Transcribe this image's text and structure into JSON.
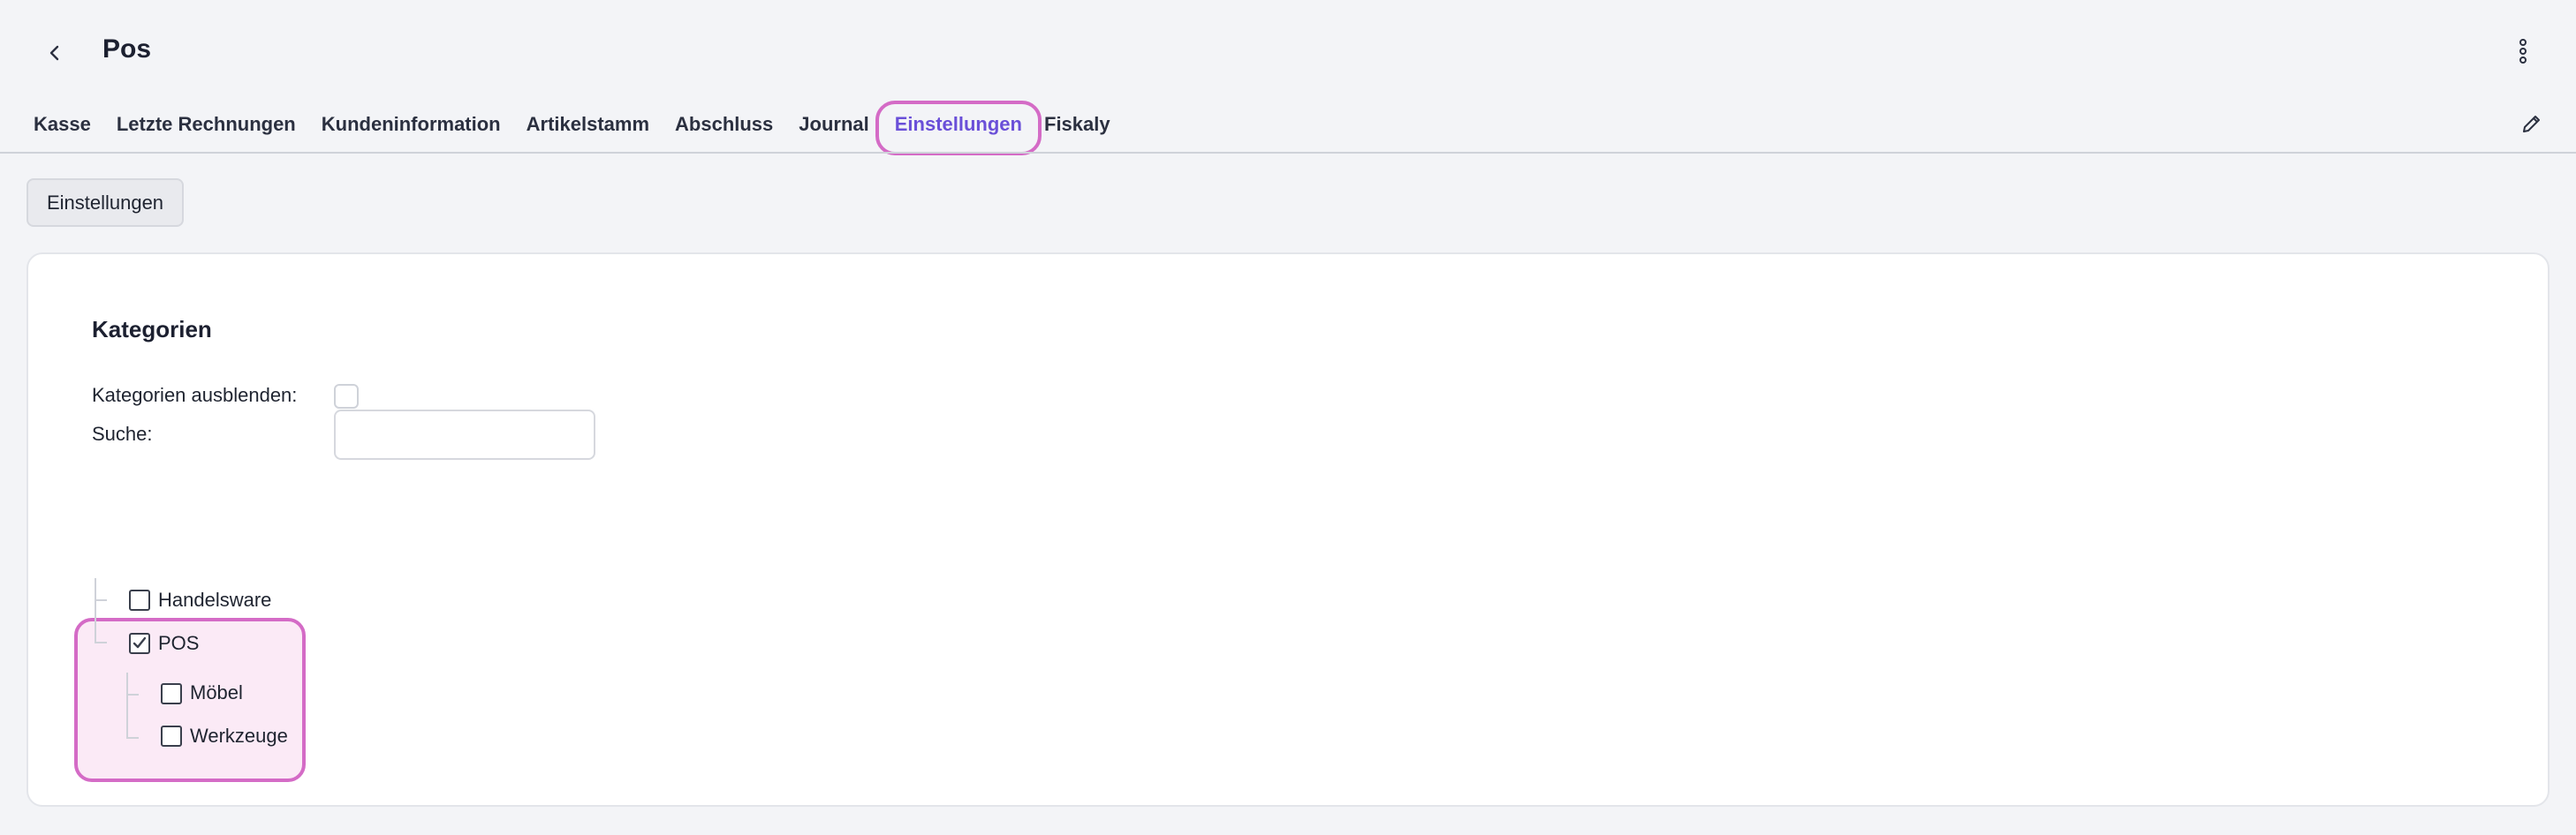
{
  "header": {
    "title": "Pos"
  },
  "icons": {
    "back": "chevron-left-icon",
    "menu": "kebab-vertical-icon",
    "edit": "pencil-icon",
    "check": "checkmark-icon"
  },
  "tabs": [
    {
      "label": "Kasse"
    },
    {
      "label": "Letzte Rechnungen"
    },
    {
      "label": "Kundeninformation"
    },
    {
      "label": "Artikelstamm"
    },
    {
      "label": "Abschluss"
    },
    {
      "label": "Journal"
    },
    {
      "label": "Einstellungen",
      "active": true
    },
    {
      "label": "Fiskaly"
    }
  ],
  "subnav": {
    "button_label": "Einstellungen"
  },
  "section": {
    "title": "Kategorien",
    "hide_label": "Kategorien ausblenden:",
    "hide_checked": false,
    "search_label": "Suche:",
    "search_value": "",
    "search_placeholder": ""
  },
  "tree": {
    "handelsware": {
      "label": "Handelsware",
      "checked": false
    },
    "pos": {
      "label": "POS",
      "checked": true
    },
    "moebel": {
      "label": "Möbel",
      "checked": false
    },
    "werkzeuge": {
      "label": "Werkzeuge",
      "checked": false
    }
  },
  "colors": {
    "accent": "#6a4fd8",
    "highlight_border": "#d46bc6",
    "highlight_fill": "#fbeaf6",
    "background": "#f3f4f7"
  }
}
